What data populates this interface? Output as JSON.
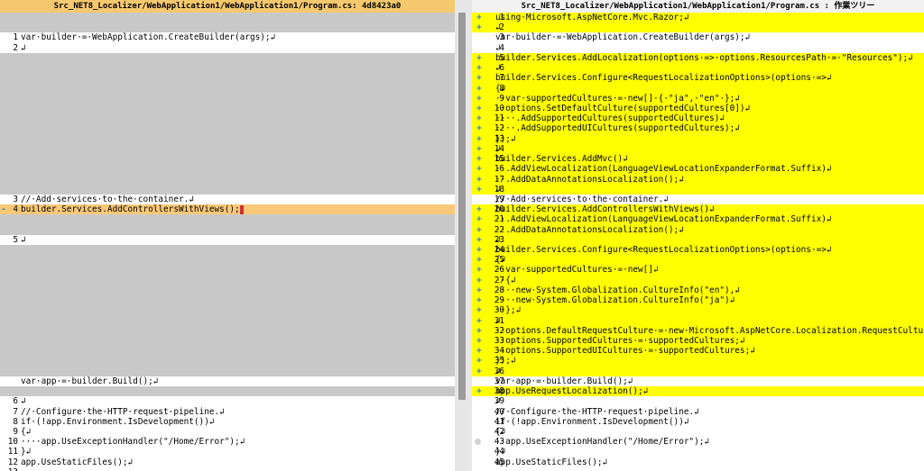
{
  "left": {
    "title": "Src_NET8_Localizer/WebApplication1/WebApplication1/Program.cs: 4d8423a0",
    "rows": [
      {
        "kind": "gap",
        "ln": "",
        "code": ""
      },
      {
        "kind": "gap",
        "ln": "",
        "code": ""
      },
      {
        "kind": "same",
        "ln": "1",
        "code": "var·builder·=·WebApplication.CreateBuilder(args);↲"
      },
      {
        "kind": "same",
        "ln": "2",
        "code": "↲"
      },
      {
        "kind": "gap",
        "ln": "",
        "code": ""
      },
      {
        "kind": "gap",
        "ln": "",
        "code": ""
      },
      {
        "kind": "gap",
        "ln": "",
        "code": ""
      },
      {
        "kind": "gap",
        "ln": "",
        "code": ""
      },
      {
        "kind": "gap",
        "ln": "",
        "code": ""
      },
      {
        "kind": "gap",
        "ln": "",
        "code": ""
      },
      {
        "kind": "gap",
        "ln": "",
        "code": ""
      },
      {
        "kind": "gap",
        "ln": "",
        "code": ""
      },
      {
        "kind": "gap",
        "ln": "",
        "code": ""
      },
      {
        "kind": "gap",
        "ln": "",
        "code": ""
      },
      {
        "kind": "gap",
        "ln": "",
        "code": ""
      },
      {
        "kind": "gap",
        "ln": "",
        "code": ""
      },
      {
        "kind": "gap",
        "ln": "",
        "code": ""
      },
      {
        "kind": "gap",
        "ln": "",
        "code": ""
      },
      {
        "kind": "same",
        "ln": "3",
        "code": "//·Add·services·to·the·container.↲"
      },
      {
        "kind": "changed-l",
        "ln": "4",
        "mark": "-",
        "code": "builder.Services.AddControllersWithViews();"
      },
      {
        "kind": "gap",
        "ln": "",
        "code": ""
      },
      {
        "kind": "gap",
        "ln": "",
        "code": ""
      },
      {
        "kind": "same",
        "ln": "5",
        "code": "↲"
      },
      {
        "kind": "gap",
        "ln": "",
        "code": ""
      },
      {
        "kind": "gap",
        "ln": "",
        "code": ""
      },
      {
        "kind": "gap",
        "ln": "",
        "code": ""
      },
      {
        "kind": "gap",
        "ln": "",
        "code": ""
      },
      {
        "kind": "gap",
        "ln": "",
        "code": ""
      },
      {
        "kind": "gap",
        "ln": "",
        "code": ""
      },
      {
        "kind": "gap",
        "ln": "",
        "code": ""
      },
      {
        "kind": "gap",
        "ln": "",
        "code": ""
      },
      {
        "kind": "gap",
        "ln": "",
        "code": ""
      },
      {
        "kind": "gap",
        "ln": "",
        "code": ""
      },
      {
        "kind": "gap",
        "ln": "",
        "code": ""
      },
      {
        "kind": "gap",
        "ln": "",
        "code": ""
      },
      {
        "kind": "gap",
        "ln": "",
        "code": ""
      },
      {
        "kind": "same",
        "ln": "",
        "code": "var·app·=·builder.Build();↲"
      },
      {
        "kind": "gap",
        "ln": "",
        "code": ""
      },
      {
        "kind": "same",
        "ln": "6",
        "code": "↲"
      },
      {
        "kind": "same",
        "ln": "7",
        "code": "//·Configure·the·HTTP·request·pipeline.↲"
      },
      {
        "kind": "same",
        "ln": "8",
        "code": "if·(!app.Environment.IsDevelopment())↲"
      },
      {
        "kind": "same",
        "ln": "9",
        "code": "{↲"
      },
      {
        "kind": "same",
        "ln": "10",
        "code": "····app.UseExceptionHandler(\"/Home/Error\");↲"
      },
      {
        "kind": "same",
        "ln": "11",
        "code": "}↲"
      },
      {
        "kind": "same",
        "ln": "12",
        "code": "app.UseStaticFiles();↲"
      },
      {
        "kind": "same",
        "ln": "13",
        "code": ""
      }
    ]
  },
  "right": {
    "title": "Src_NET8_Localizer/WebApplication1/WebApplication1/Program.cs : 作業ツリー",
    "rows": [
      {
        "kind": "added",
        "ln": "1",
        "mark": "+",
        "code": "using·Microsoft.AspNetCore.Mvc.Razor;↲"
      },
      {
        "kind": "added",
        "ln": "2",
        "mark": "+",
        "code": "↲"
      },
      {
        "kind": "same",
        "ln": "3",
        "code": "var·builder·=·WebApplication.CreateBuilder(args);↲"
      },
      {
        "kind": "same",
        "ln": "4",
        "code": "↲"
      },
      {
        "kind": "added",
        "ln": "5",
        "mark": "+",
        "code": "builder.Services.AddLocalization(options·=>·options.ResourcesPath·=·\"Resources\");↲"
      },
      {
        "kind": "added",
        "ln": "6",
        "mark": "+",
        "code": "↲"
      },
      {
        "kind": "added",
        "ln": "7",
        "mark": "+",
        "code": "builder.Services.Configure<RequestLocalizationOptions>(options·=>↲"
      },
      {
        "kind": "added",
        "ln": "8",
        "mark": "+",
        "code": "{↲"
      },
      {
        "kind": "added",
        "ln": "9",
        "mark": "+",
        "code": "··var·supportedCultures·=·new[]·{·\"ja\",·\"en\"·};↲"
      },
      {
        "kind": "added",
        "ln": "10",
        "mark": "+",
        "code": "··options.SetDefaultCulture(supportedCultures[0])↲"
      },
      {
        "kind": "added",
        "ln": "11",
        "mark": "+",
        "code": "····.AddSupportedCultures(supportedCultures)↲"
      },
      {
        "kind": "added",
        "ln": "12",
        "mark": "+",
        "code": "····.AddSupportedUICultures(supportedCultures);↲"
      },
      {
        "kind": "added",
        "ln": "13",
        "mark": "+",
        "code": "});↲"
      },
      {
        "kind": "added",
        "ln": "14",
        "mark": "+",
        "code": "↲"
      },
      {
        "kind": "added",
        "ln": "15",
        "mark": "+",
        "code": "builder.Services.AddMvc()↲"
      },
      {
        "kind": "added",
        "ln": "16",
        "mark": "+",
        "code": "··.AddViewLocalization(LanguageViewLocationExpanderFormat.Suffix)↲"
      },
      {
        "kind": "added",
        "ln": "17",
        "mark": "+",
        "code": "··.AddDataAnnotationsLocalization();↲"
      },
      {
        "kind": "added",
        "ln": "18",
        "mark": "+",
        "code": "↲"
      },
      {
        "kind": "same",
        "ln": "19",
        "code": "//·Add·services·to·the·container.↲"
      },
      {
        "kind": "added",
        "ln": "20",
        "mark": "+",
        "code": "builder.Services.AddControllersWithViews()↲"
      },
      {
        "kind": "added",
        "ln": "21",
        "mark": "+",
        "code": "··.AddViewLocalization(LanguageViewLocationExpanderFormat.Suffix)↲"
      },
      {
        "kind": "added",
        "ln": "22",
        "mark": "+",
        "code": "··.AddDataAnnotationsLocalization();↲"
      },
      {
        "kind": "added",
        "ln": "23",
        "mark": "+",
        "code": "↲"
      },
      {
        "kind": "added",
        "ln": "24",
        "mark": "+",
        "code": "builder.Services.Configure<RequestLocalizationOptions>(options·=>↲"
      },
      {
        "kind": "added",
        "ln": "25",
        "mark": "+",
        "code": "{↲"
      },
      {
        "kind": "added",
        "ln": "26",
        "mark": "+",
        "code": "··var·supportedCultures·=·new[]↲"
      },
      {
        "kind": "added",
        "ln": "27",
        "mark": "+",
        "code": "··{↲"
      },
      {
        "kind": "added",
        "ln": "28",
        "mark": "+",
        "code": "····new·System.Globalization.CultureInfo(\"en\"),↲"
      },
      {
        "kind": "added",
        "ln": "29",
        "mark": "+",
        "code": "····new·System.Globalization.CultureInfo(\"ja\")↲"
      },
      {
        "kind": "added",
        "ln": "30",
        "mark": "+",
        "code": "··};↲"
      },
      {
        "kind": "added",
        "ln": "31",
        "mark": "+",
        "code": "↲"
      },
      {
        "kind": "added",
        "ln": "32",
        "mark": "+",
        "code": "··options.DefaultRequestCulture·=·new·Microsoft.AspNetCore.Localization.RequestCulture(\"ja\""
      },
      {
        "kind": "added",
        "ln": "33",
        "mark": "+",
        "code": "··options.SupportedCultures·=·supportedCultures;↲"
      },
      {
        "kind": "added",
        "ln": "34",
        "mark": "+",
        "code": "··options.SupportedUICultures·=·supportedCultures;↲"
      },
      {
        "kind": "added",
        "ln": "35",
        "mark": "+",
        "code": "});↲"
      },
      {
        "kind": "added",
        "ln": "36",
        "mark": "+",
        "code": "↲"
      },
      {
        "kind": "same",
        "ln": "37",
        "code": "var·app·=·builder.Build();↲"
      },
      {
        "kind": "added",
        "ln": "38",
        "mark": "+",
        "code": "app.UseRequestLocalization();↲"
      },
      {
        "kind": "same",
        "ln": "39",
        "code": "↲"
      },
      {
        "kind": "same",
        "ln": "40",
        "code": "//·Configure·the·HTTP·request·pipeline.↲"
      },
      {
        "kind": "same",
        "ln": "41",
        "code": "if·(!app.Environment.IsDevelopment())↲"
      },
      {
        "kind": "same",
        "ln": "42",
        "code": "{↲"
      },
      {
        "kind": "same",
        "ln": "43",
        "mark": "●",
        "code": "··app.UseExceptionHandler(\"/Home/Error\");↲"
      },
      {
        "kind": "same",
        "ln": "44",
        "code": "}↲"
      },
      {
        "kind": "same",
        "ln": "45",
        "code": "app.UseStaticFiles();↲"
      }
    ]
  }
}
